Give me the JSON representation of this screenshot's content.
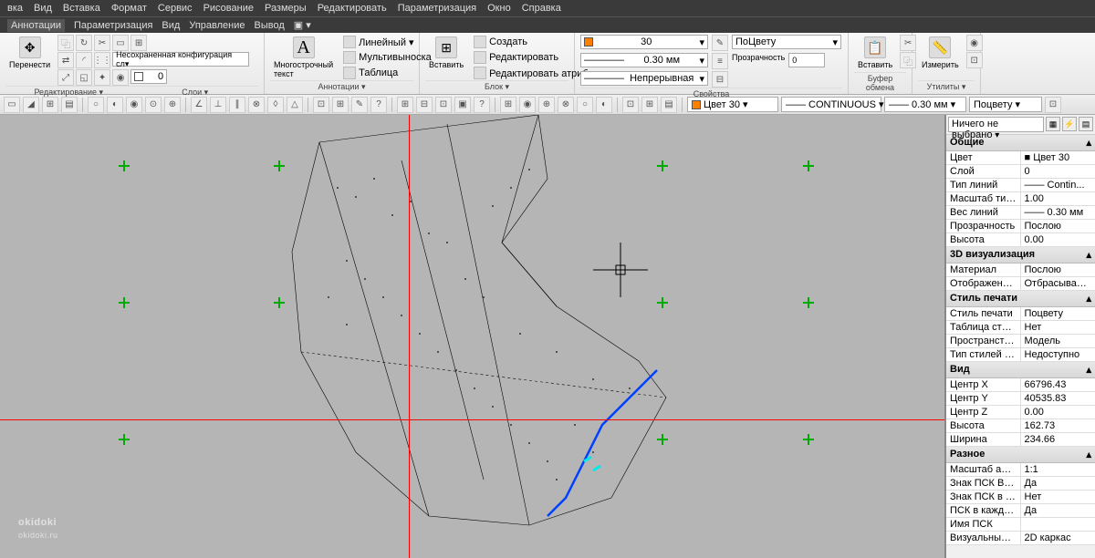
{
  "menu": [
    "вка",
    "Вид",
    "Вставка",
    "Формат",
    "Сервис",
    "Рисование",
    "Размеры",
    "Редактировать",
    "Параметризация",
    "Окно",
    "Справка"
  ],
  "tabs": [
    "Аннотации",
    "Параметризация",
    "Вид",
    "Управление",
    "Вывод"
  ],
  "ribbon": {
    "edit": {
      "big": "Перенести",
      "title": "Редактирование ▾",
      "config": "Несохраненная конфигурация сл▾"
    },
    "layers": {
      "title": "Слои ▾",
      "current": "0"
    },
    "annotation": {
      "big": "Многострочный текст",
      "title": "Аннотации ▾",
      "items": [
        "Линейный ▾",
        "Мультивыноска",
        "Таблица"
      ]
    },
    "block": {
      "big": "Вставить",
      "title": "Блок ▾",
      "items": [
        "Создать",
        "Редактировать",
        "Редактировать атрибуты ▾"
      ]
    },
    "props": {
      "title": "Свойства",
      "layer": "30",
      "bycolor": "ПоЦвету",
      "lineweight": "0.30 мм",
      "transparency_lbl": "Прозрачность",
      "transparency_val": "0",
      "linetype": "Непрерывная"
    },
    "clipboard": {
      "big": "Вставить",
      "title": "Буфер обмена"
    },
    "utils": {
      "big": "Измерить",
      "title": "Утилиты ▾"
    }
  },
  "toolbar2": {
    "color": "Цвет 30",
    "linetype": "CONTINUOUS",
    "lineweight": "0.30 мм",
    "plotstyle": "Поцвету"
  },
  "props_panel": {
    "selection": "Ничего не выбрано",
    "sections": [
      {
        "title": "Общие",
        "rows": [
          [
            "Цвет",
            "■ Цвет 30"
          ],
          [
            "Слой",
            "0"
          ],
          [
            "Тип линий",
            "—— Contin..."
          ],
          [
            "Масштаб типа л...",
            "1.00"
          ],
          [
            "Вес линий",
            "—— 0.30 мм"
          ],
          [
            "Прозрачность",
            "Послою"
          ],
          [
            "Высота",
            "0.00"
          ]
        ]
      },
      {
        "title": "3D визуализация",
        "rows": [
          [
            "Материал",
            "Послою"
          ],
          [
            "Отображение те...",
            "Отбрасываема..."
          ]
        ]
      },
      {
        "title": "Стиль печати",
        "rows": [
          [
            "Стиль печати",
            "Поцвету"
          ],
          [
            "Таблица стилей ...",
            "Нет"
          ],
          [
            "Пространство та...",
            "Модель"
          ],
          [
            "Тип стилей печати",
            "Недоступно"
          ]
        ]
      },
      {
        "title": "Вид",
        "rows": [
          [
            "Центр X",
            "66796.43"
          ],
          [
            "Центр Y",
            "40535.83"
          ],
          [
            "Центр Z",
            "0.00"
          ],
          [
            "Высота",
            "162.73"
          ],
          [
            "Ширина",
            "234.66"
          ]
        ]
      },
      {
        "title": "Разное",
        "rows": [
          [
            "Масштаб аннота...",
            "1:1"
          ],
          [
            "Знак ПСК ВКЛ",
            "Да"
          ],
          [
            "Знак ПСК в нач. ...",
            "Нет"
          ],
          [
            "ПСК в каждом В...",
            "Да"
          ],
          [
            "Имя ПСК",
            ""
          ],
          [
            "Визуальный стиль",
            "2D каркас"
          ]
        ]
      }
    ]
  },
  "colors": {
    "layer30": "#ff8000"
  },
  "watermark": {
    "brand": "okidoki",
    "site": "okidoki.ru"
  }
}
